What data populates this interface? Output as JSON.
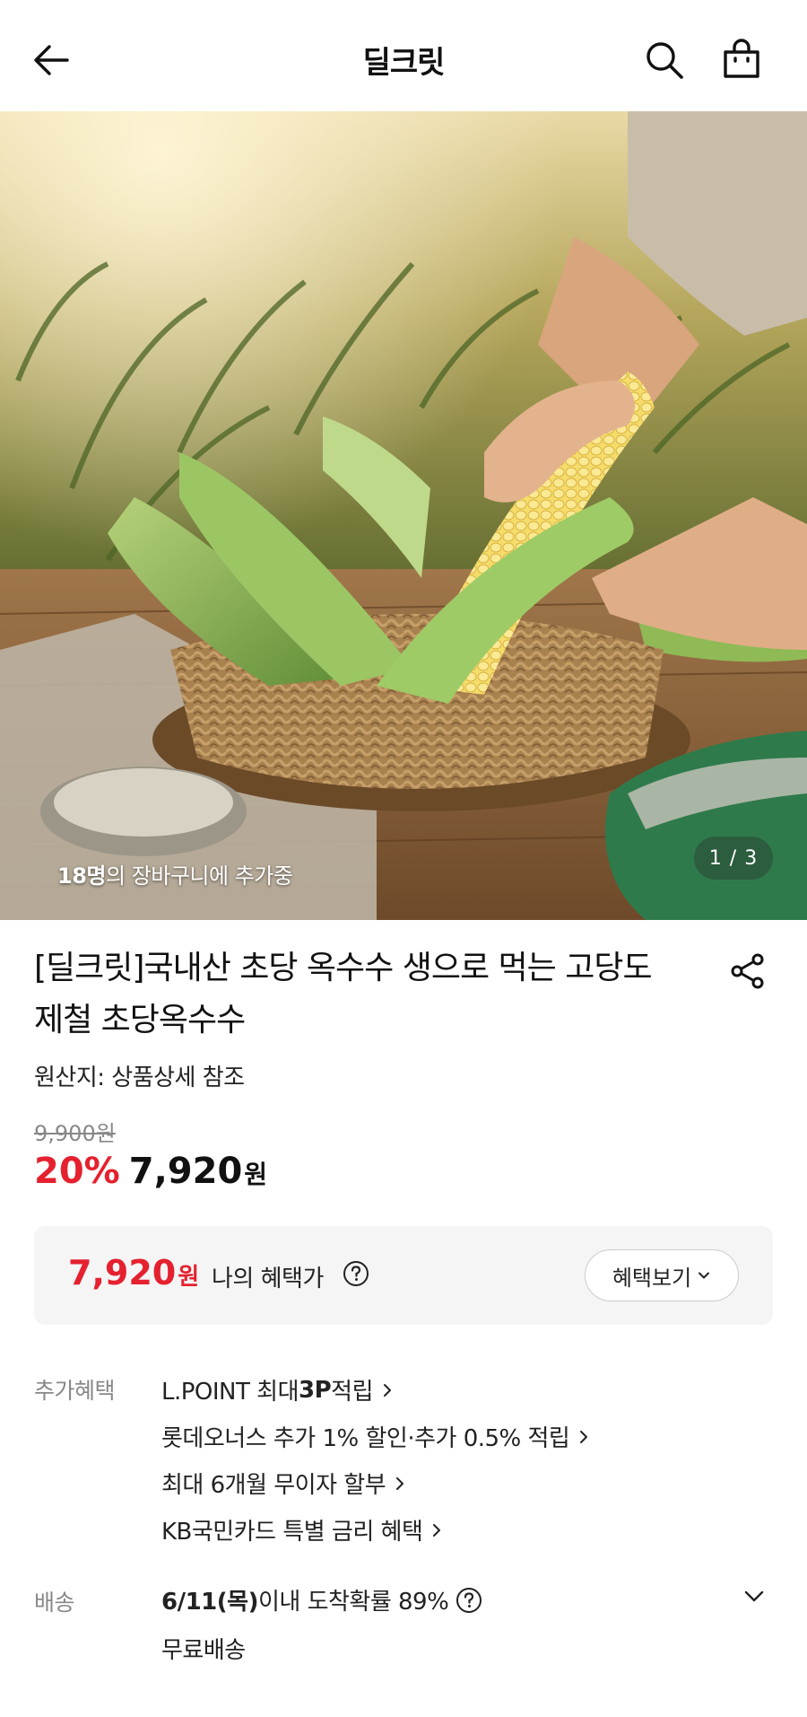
{
  "header": {
    "title": "딜크릿",
    "icons": {
      "back": "arrow-left-icon",
      "search": "search-icon",
      "cart": "shopping-bag-icon"
    }
  },
  "hero": {
    "cart_count_bold": "18명",
    "cart_count_text": "의 장바구니에 추가중",
    "image_counter": "1 / 3"
  },
  "product": {
    "title_line1": "[딜크릿]국내산 초당 옥수수 생으로 먹는 고당도",
    "title_line2": "제철 초당옥수수",
    "origin": "원산지: 상품상세 참조",
    "original_price": "9,900원",
    "discount": "20%",
    "price": "7,920",
    "price_unit": "원"
  },
  "benefit_box": {
    "my_price": "7,920",
    "my_price_unit": "원",
    "label": "나의 혜택가",
    "button_label": "혜택보기"
  },
  "extra_benefits": {
    "label": "추가혜택",
    "items": [
      {
        "pre": "L.POINT 최대 ",
        "bold": "3P",
        "post": " 적립"
      },
      {
        "pre": "롯데오너스 추가 1% 할인·추가 0.5% 적립",
        "bold": "",
        "post": ""
      },
      {
        "pre": "최대 6개월 무이자 할부",
        "bold": "",
        "post": ""
      },
      {
        "pre": "KB국민카드 특별 금리 혜택",
        "bold": "",
        "post": ""
      }
    ]
  },
  "shipping": {
    "label": "배송",
    "date_bold": "6/11(목)",
    "date_text": " 이내 도착확률 89%",
    "fee": "무료배송"
  },
  "colors": {
    "accent_red": "#e5212f",
    "text": "#111111",
    "muted": "#888888",
    "box_bg": "#f5f5f5"
  }
}
